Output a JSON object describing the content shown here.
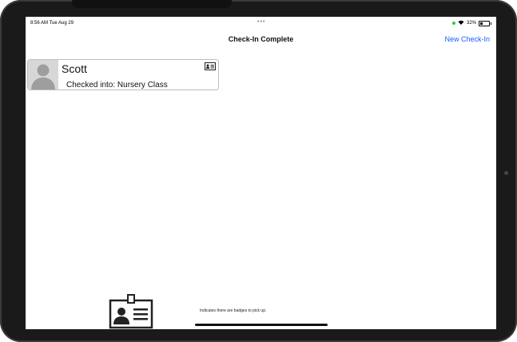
{
  "status_bar": {
    "time": "8:56 AM  Tue Aug 29",
    "center_dots": "•••",
    "battery_text": "32%",
    "battery_level": 0.32
  },
  "nav": {
    "title": "Check-In Complete",
    "new_checkin_label": "New Check-In"
  },
  "checkins": [
    {
      "name": "Scott",
      "status": "Checked into: Nursery Class",
      "has_badge": true
    }
  ],
  "footer": {
    "badge_note": "Indicates there are badges to pick up."
  },
  "colors": {
    "accent": "#1a5cff",
    "avatar_bg": "#d7d7d7",
    "avatar_fg": "#9e9e9e",
    "wifi_indicator": "#2ecc40"
  },
  "icons": {
    "card_badge": "id-badge-icon",
    "footer_badge": "id-badge-icon",
    "avatar": "person-silhouette-icon"
  }
}
